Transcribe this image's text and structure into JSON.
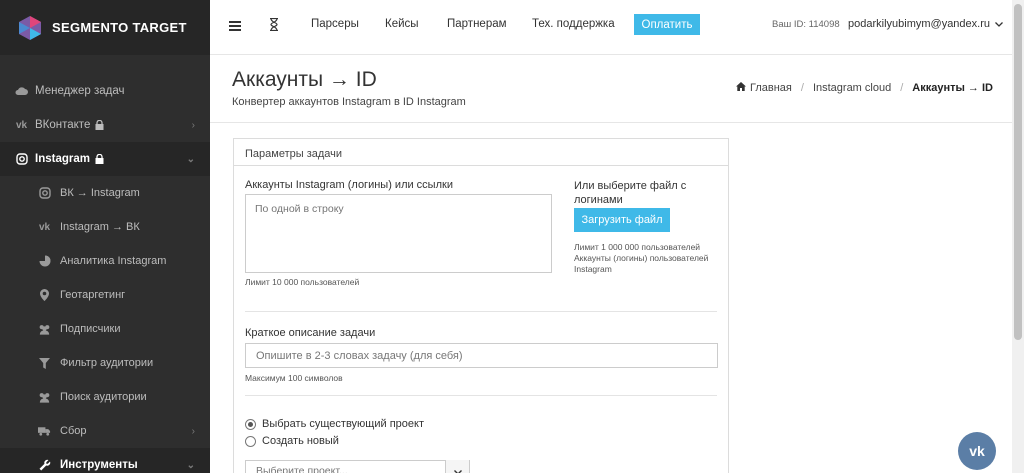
{
  "brand": {
    "name": "SEGMENTO TARGET"
  },
  "sidebar": {
    "items": [
      {
        "label": "Менеджер задач",
        "icon": "cloud-icon"
      },
      {
        "label": "ВКонтакте",
        "icon": "vk-icon",
        "locked": true,
        "chevron": "›"
      },
      {
        "label": "Instagram",
        "icon": "instagram-icon",
        "locked": true,
        "chevron": "⌄"
      },
      {
        "label": "ВК → Instagram",
        "icon": "instagram-icon"
      },
      {
        "label": "Instagram → ВК",
        "icon": "vk-icon"
      },
      {
        "label": "Аналитика Instagram",
        "icon": "pie-chart-icon"
      },
      {
        "label": "Геотаргетинг",
        "icon": "map-pin-icon"
      },
      {
        "label": "Подписчики",
        "icon": "users-icon"
      },
      {
        "label": "Фильтр аудитории",
        "icon": "filter-icon"
      },
      {
        "label": "Поиск аудитории",
        "icon": "users-icon"
      },
      {
        "label": "Сбор",
        "icon": "truck-icon",
        "chevron": "›"
      },
      {
        "label": "Инструменты",
        "icon": "wrench-icon",
        "chevron": "⌄"
      }
    ]
  },
  "topbar": {
    "nav": [
      "Парсеры",
      "Кейсы",
      "Партнерам",
      "Тех. поддержка"
    ],
    "pay_label": "Оплатить",
    "user_id": "Ваш ID: 114098",
    "email": "podarkilyubimym@yandex.ru"
  },
  "page": {
    "title": "Аккаунты → ID",
    "subtitle": "Конвертер аккаунтов Instagram в ID Instagram",
    "breadcrumb": [
      "Главная",
      "Instagram cloud",
      "Аккаунты → ID"
    ]
  },
  "panel": {
    "heading": "Параметры задачи",
    "accounts_label": "Аккаунты Instagram (логины) или ссылки",
    "accounts_placeholder": "По одной в строку",
    "accounts_limit": "Лимит 10 000 пользователей",
    "file_label": "Или выберите файл с логинами",
    "upload_label": "Загрузить файл",
    "file_hint": "Лимит 1 000 000 пользователей Аккаунты (логины) пользователей Instagram",
    "desc_label": "Краткое описание задачи",
    "desc_placeholder": "Опишите в 2-3 словах задачу (для себя)",
    "desc_limit": "Максимум 100 символов",
    "radio_existing": "Выбрать существующий проект",
    "radio_new": "Создать новый",
    "select_placeholder": "Выберите проект..."
  },
  "colors": {
    "accent": "#3fb9e8",
    "sidebar": "#2e2e2e",
    "vk": "#5b7ea6"
  }
}
